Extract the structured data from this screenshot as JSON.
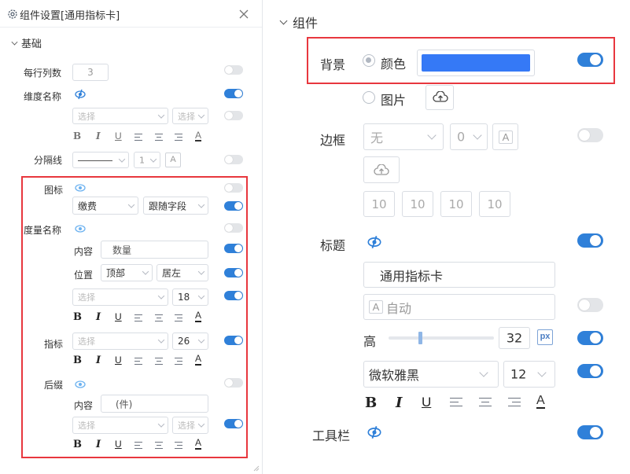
{
  "left": {
    "title": "组件设置[通用指标卡]",
    "section": "基础",
    "per_row_label": "每行列数",
    "per_row_value": "3",
    "dim_name_label": "维度名称",
    "select_placeholder": "选择",
    "divider_label": "分隔线",
    "divider_width": "1",
    "icon_label": "图标",
    "icon_select": "缴费",
    "icon_follow": "跟随字段",
    "measure_label": "度量名称",
    "content_label": "内容",
    "measure_content": "数量",
    "position_label": "位置",
    "pos_vertical": "顶部",
    "pos_horizontal": "居左",
    "font_size_18": "18",
    "indicator_label": "指标",
    "font_size_26": "26",
    "suffix_label": "后缀",
    "suffix_content": "(件)",
    "bold": "B",
    "italic": "I",
    "underline": "U",
    "fontcolor": "A"
  },
  "right": {
    "section": "组件",
    "bg_label": "背景",
    "color_option": "颜色",
    "image_option": "图片",
    "bg_color": "#3579f6",
    "border_label": "边框",
    "border_style": "无",
    "border_width": "0",
    "font_color_letter": "A",
    "radius": [
      "10",
      "10",
      "10",
      "10"
    ],
    "title_label": "标题",
    "title_value": "通用指标卡",
    "auto_label": "自动",
    "height_label": "高",
    "height_value": "32",
    "unit": "px",
    "font_family": "微软雅黑",
    "font_size": "12",
    "toolbar_label": "工具栏",
    "bold": "B",
    "italic": "I",
    "underline": "U",
    "fontcolor": "A"
  },
  "colors": {
    "accent": "#2f80d9",
    "highlight_border": "#e8373e",
    "toggle_off": "#e3e5e8"
  }
}
